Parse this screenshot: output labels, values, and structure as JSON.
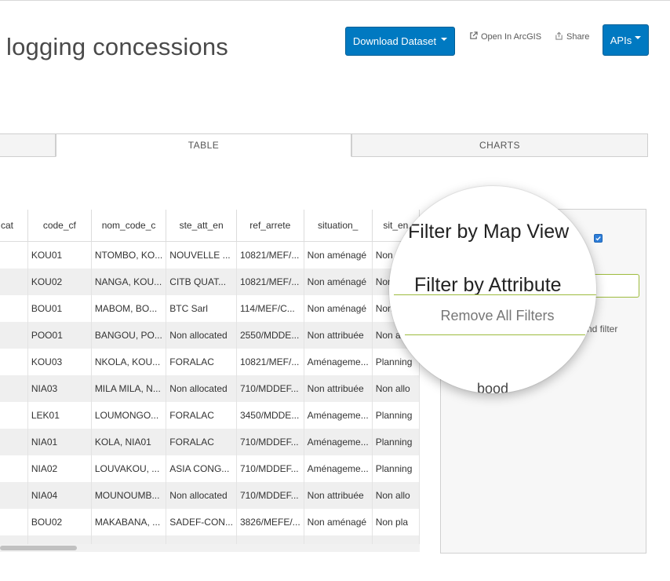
{
  "header": {
    "title": "logging concessions",
    "download_label": "Download Dataset",
    "open_arcgis_label": "Open In ArcGIS",
    "share_label": "Share",
    "apis_label": "APIs"
  },
  "tabs": [
    {
      "label": ""
    },
    {
      "label": "TABLE"
    },
    {
      "label": "CHARTS"
    }
  ],
  "table": {
    "columns": [
      "cat",
      "code_cf",
      "nom_code_c",
      "ste_att_en",
      "ref_arrete",
      "situation_",
      "sit_en"
    ],
    "rows": [
      [
        "",
        "KOU01",
        "NTOMBO, KO...",
        "NOUVELLE ...",
        "10821/MEF/...",
        "Non aménagé",
        "Non n"
      ],
      [
        "",
        "KOU02",
        "NANGA, KOU...",
        "CITB QUAT...",
        "10821/MEF/...",
        "Non aménagé",
        "Non"
      ],
      [
        "",
        "BOU01",
        "MABOM, BO...",
        "BTC Sarl",
        "114/MEF/C...",
        "Non aménagé",
        "Non"
      ],
      [
        "",
        "POO01",
        "BANGOU, PO...",
        "Non allocated",
        "2550/MDDE...",
        "Non attribuée",
        "Non a"
      ],
      [
        "",
        "KOU03",
        "NKOLA, KOU...",
        "FORALAC",
        "10821/MEF/...",
        "Aménageme...",
        "Planning"
      ],
      [
        "",
        "NIA03",
        "MILA MILA, N...",
        "Non allocated",
        "710/MDDEF...",
        "Non attribuée",
        "Non allo"
      ],
      [
        "",
        "LEK01",
        "LOUMONGO...",
        "FORALAC",
        "3450/MDDE...",
        "Aménageme...",
        "Planning"
      ],
      [
        "",
        "NIA01",
        "KOLA, NIA01",
        "FORALAC",
        "710/MDDEF...",
        "Aménageme...",
        "Planning"
      ],
      [
        "",
        "NIA02",
        "LOUVAKOU, ...",
        "ASIA CONG...",
        "710/MDDEF...",
        "Aménageme...",
        "Planning"
      ],
      [
        "",
        "NIA04",
        "MOUNOUMB...",
        "Non allocated",
        "710/MDDEF...",
        "Non attribuée",
        "Non allo"
      ],
      [
        "",
        "BOU02",
        "MAKABANA, ...",
        "SADEF-CON...",
        "3826/MEFE/...",
        "Non aménagé",
        "Non pla"
      ],
      [
        "",
        "",
        "",
        "",
        "",
        "",
        ""
      ]
    ]
  },
  "filter_panel": {
    "filter_map_view_label": "Filter by Map View",
    "filter_map_view_checked": true,
    "filter_attribute_label": "Filter by Attribute",
    "remove_all_label": "Remove All Filters",
    "side_fragment": "nd filter",
    "cut_fragment": "bood"
  },
  "colors": {
    "accent": "#0079c1",
    "input_border": "#9dbb3e",
    "checkbox": "#2f7ed8"
  }
}
